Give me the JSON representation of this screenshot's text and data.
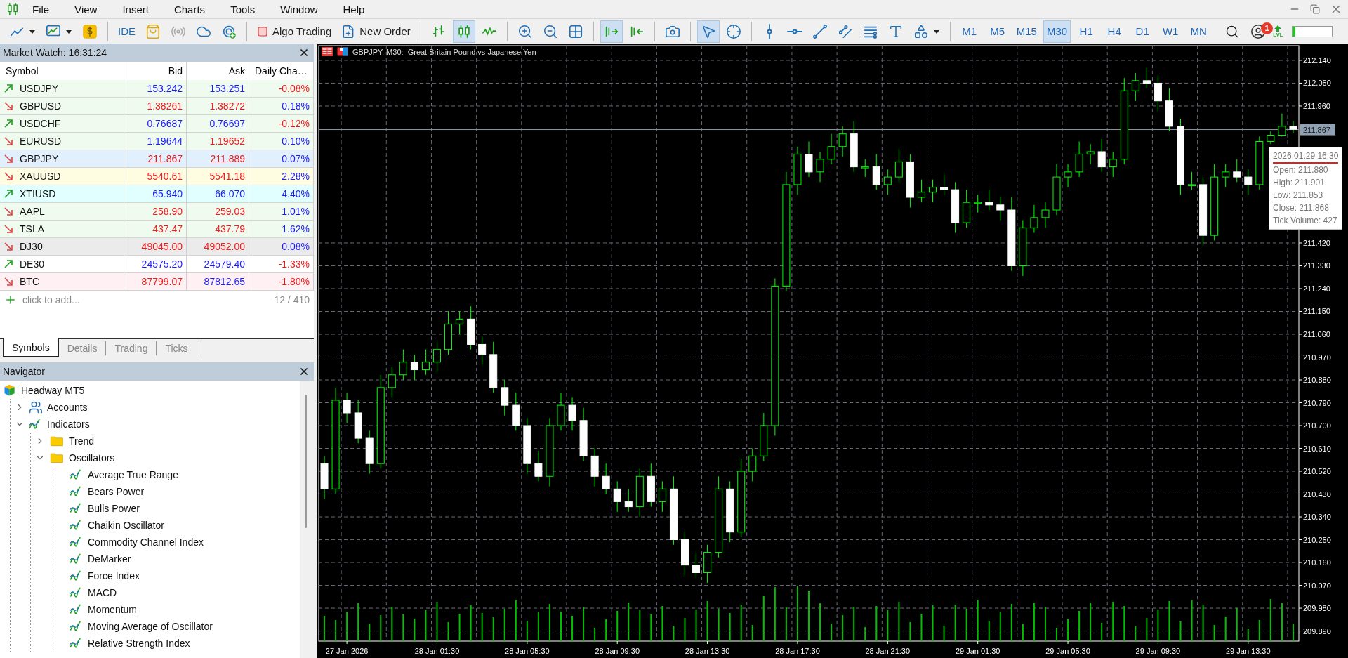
{
  "menu": {
    "items": [
      "File",
      "View",
      "Insert",
      "Charts",
      "Tools",
      "Window",
      "Help"
    ]
  },
  "toolbar": {
    "ide": "IDE",
    "algo_trading": "Algo Trading",
    "new_order": "New Order",
    "chart_types": [
      {
        "kind": "bars",
        "selected": false
      },
      {
        "kind": "candles",
        "selected": true
      },
      {
        "kind": "line",
        "selected": false
      }
    ],
    "autoscroll": {
      "selected": true
    },
    "chart_shift": {
      "selected": false
    },
    "tools": [
      {
        "kind": "cursor",
        "selected": true
      },
      {
        "kind": "crosshair",
        "selected": false
      },
      {
        "kind": "vertical_line",
        "selected": false
      },
      {
        "kind": "horizontal_line",
        "selected": false
      },
      {
        "kind": "trend_line",
        "selected": false
      },
      {
        "kind": "channel",
        "selected": false
      },
      {
        "kind": "fibonacci",
        "selected": false
      },
      {
        "kind": "text",
        "selected": false
      },
      {
        "kind": "shapes",
        "selected": false
      }
    ],
    "timeframes": [
      {
        "label": "M1",
        "selected": false
      },
      {
        "label": "M5",
        "selected": false
      },
      {
        "label": "M15",
        "selected": false
      },
      {
        "label": "M30",
        "selected": true
      },
      {
        "label": "H1",
        "selected": false
      },
      {
        "label": "H4",
        "selected": false
      },
      {
        "label": "D1",
        "selected": false
      },
      {
        "label": "W1",
        "selected": false
      },
      {
        "label": "MN",
        "selected": false
      }
    ],
    "notification_badge": "1",
    "lvl_label": "LVL",
    "meter": {
      "level": 0.08
    }
  },
  "market_watch": {
    "title": "Market Watch: 16:31:24",
    "columns": [
      "Symbol",
      "Bid",
      "Ask",
      "Daily Cha…"
    ],
    "rows": [
      {
        "symbol": "USDJPY",
        "rising": true,
        "bid": {
          "text": "153.242",
          "color": "#1a1aff"
        },
        "ask": {
          "text": "153.251",
          "color": "#1a1aff"
        },
        "change": {
          "text": "-0.08%",
          "color": "#f01818"
        },
        "color": "#f0fbf0"
      },
      {
        "symbol": "GBPUSD",
        "rising": false,
        "bid": {
          "text": "1.38261",
          "color": "#f01818"
        },
        "ask": {
          "text": "1.38272",
          "color": "#f01818"
        },
        "change": {
          "text": "0.18%",
          "color": "#1a1aff"
        },
        "color": "#f0fbf0"
      },
      {
        "symbol": "USDCHF",
        "rising": true,
        "bid": {
          "text": "0.76687",
          "color": "#1a1aff"
        },
        "ask": {
          "text": "0.76697",
          "color": "#1a1aff"
        },
        "change": {
          "text": "-0.12%",
          "color": "#f01818"
        },
        "color": "#f0fbf0"
      },
      {
        "symbol": "EURUSD",
        "rising": false,
        "bid": {
          "text": "1.19644",
          "color": "#1a1aff"
        },
        "ask": {
          "text": "1.19652",
          "color": "#f01818"
        },
        "change": {
          "text": "0.10%",
          "color": "#1a1aff"
        },
        "color": "#f0fbf0"
      },
      {
        "symbol": "GBPJPY",
        "rising": false,
        "bid": {
          "text": "211.867",
          "color": "#f01818"
        },
        "ask": {
          "text": "211.889",
          "color": "#f01818"
        },
        "change": {
          "text": "0.07%",
          "color": "#1a1aff"
        },
        "color": "#e2effc"
      },
      {
        "symbol": "XAUUSD",
        "rising": false,
        "bid": {
          "text": "5540.61",
          "color": "#f01818"
        },
        "ask": {
          "text": "5541.18",
          "color": "#f01818"
        },
        "change": {
          "text": "2.28%",
          "color": "#1a1aff"
        },
        "color": "#fffde1"
      },
      {
        "symbol": "XTIUSD",
        "rising": true,
        "bid": {
          "text": "65.940",
          "color": "#1a1aff"
        },
        "ask": {
          "text": "66.070",
          "color": "#1a1aff"
        },
        "change": {
          "text": "4.40%",
          "color": "#1a1aff"
        },
        "color": "#e1ffff"
      },
      {
        "symbol": "AAPL",
        "rising": false,
        "bid": {
          "text": "258.90",
          "color": "#f01818"
        },
        "ask": {
          "text": "259.03",
          "color": "#f01818"
        },
        "change": {
          "text": "1.01%",
          "color": "#1a1aff"
        },
        "color": "#f0fbf0"
      },
      {
        "symbol": "TSLA",
        "rising": false,
        "bid": {
          "text": "437.47",
          "color": "#f01818"
        },
        "ask": {
          "text": "437.79",
          "color": "#f01818"
        },
        "change": {
          "text": "1.62%",
          "color": "#1a1aff"
        },
        "color": "#f0fbf0"
      },
      {
        "symbol": "DJ30",
        "rising": false,
        "bid": {
          "text": "49045.00",
          "color": "#f01818"
        },
        "ask": {
          "text": "49052.00",
          "color": "#f01818"
        },
        "change": {
          "text": "0.08%",
          "color": "#1a1aff"
        },
        "color": "#ebebeb"
      },
      {
        "symbol": "DE30",
        "rising": true,
        "bid": {
          "text": "24575.20",
          "color": "#1a1aff"
        },
        "ask": {
          "text": "24579.40",
          "color": "#1a1aff"
        },
        "change": {
          "text": "-1.33%",
          "color": "#f01818"
        },
        "color": "#ffffff"
      },
      {
        "symbol": "BTC",
        "rising": false,
        "bid": {
          "text": "87799.07",
          "color": "#f01818"
        },
        "ask": {
          "text": "87812.65",
          "color": "#1a1aff"
        },
        "change": {
          "text": "-1.80%",
          "color": "#f01818"
        },
        "color": "#fff0f3"
      }
    ],
    "add_label": "click to add...",
    "count": "12 / 410",
    "tabs": [
      {
        "label": "Symbols",
        "selected": true
      },
      {
        "label": "Details",
        "selected": false
      },
      {
        "label": "Trading",
        "selected": false
      },
      {
        "label": "Ticks",
        "selected": false
      }
    ]
  },
  "navigator": {
    "title": "Navigator",
    "tree": [
      {
        "label": "Headway MT5",
        "kind": "broker",
        "children": [
          {
            "label": "Accounts",
            "kind": "accounts",
            "expanded": false
          },
          {
            "label": "Indicators",
            "kind": "indicator",
            "expanded": true,
            "children": [
              {
                "label": "Trend",
                "kind": "folder",
                "expanded": false
              },
              {
                "label": "Oscillators",
                "kind": "folder",
                "expanded": true,
                "children": [
                  {
                    "label": "Average True Range",
                    "kind": "indicator"
                  },
                  {
                    "label": "Bears Power",
                    "kind": "indicator"
                  },
                  {
                    "label": "Bulls Power",
                    "kind": "indicator"
                  },
                  {
                    "label": "Chaikin Oscillator",
                    "kind": "indicator"
                  },
                  {
                    "label": "Commodity Channel Index",
                    "kind": "indicator"
                  },
                  {
                    "label": "DeMarker",
                    "kind": "indicator"
                  },
                  {
                    "label": "Force Index",
                    "kind": "indicator"
                  },
                  {
                    "label": "MACD",
                    "kind": "indicator"
                  },
                  {
                    "label": "Momentum",
                    "kind": "indicator"
                  },
                  {
                    "label": "Moving Average of Oscillator",
                    "kind": "indicator"
                  },
                  {
                    "label": "Relative Strength Index",
                    "kind": "indicator"
                  }
                ]
              }
            ]
          }
        ]
      }
    ]
  },
  "chart": {
    "title": "GBPJPY, M30:  Great Britain Pound vs Japanese Yen",
    "tooltip": {
      "time": "2026.01.29 16:30",
      "lines": [
        "Open: 211.880",
        "High: 211.901",
        "Low: 211.853",
        "Close: 211.868",
        "Tick Volume: 427"
      ]
    },
    "chart_data": {
      "type": "candlestick",
      "grid": true,
      "categories": [
        null,
        null,
        "27 Jan 2026",
        null,
        null,
        null,
        null,
        null,
        null,
        null,
        "28 Jan 01:30",
        null,
        null,
        null,
        null,
        null,
        null,
        null,
        "28 Jan 05:30",
        null,
        null,
        null,
        null,
        null,
        null,
        null,
        "28 Jan 09:30",
        null,
        null,
        null,
        null,
        null,
        null,
        null,
        "28 Jan 13:30",
        null,
        null,
        null,
        null,
        null,
        null,
        null,
        "28 Jan 17:30",
        null,
        null,
        null,
        null,
        null,
        null,
        null,
        "28 Jan 21:30",
        null,
        null,
        null,
        null,
        null,
        null,
        null,
        "29 Jan 01:30",
        null,
        null,
        null,
        null,
        null,
        null,
        null,
        "29 Jan 05:30",
        null,
        null,
        null,
        null,
        null,
        null,
        null,
        "29 Jan 09:30",
        null,
        null,
        null,
        null,
        null,
        null,
        null,
        "29 Jan 13:30",
        null,
        null,
        null,
        null
      ],
      "ylim": [
        209.85,
        212.198
      ],
      "ref_lines": [
        {
          "axis": "y",
          "value": 211.867,
          "label": "211.867"
        }
      ],
      "ohlc": [
        [
          210.55,
          210.58,
          210.41,
          210.45
        ],
        [
          210.45,
          210.85,
          210.43,
          210.8
        ],
        [
          210.8,
          210.83,
          210.71,
          210.75
        ],
        [
          210.75,
          210.8,
          210.63,
          210.65
        ],
        [
          210.65,
          210.68,
          210.51,
          210.55
        ],
        [
          210.55,
          210.9,
          210.53,
          210.85
        ],
        [
          210.85,
          210.93,
          210.81,
          210.9
        ],
        [
          210.9,
          211.0,
          210.88,
          210.95
        ],
        [
          210.95,
          210.98,
          210.88,
          210.92
        ],
        [
          210.92,
          211.0,
          210.9,
          210.95
        ],
        [
          210.95,
          211.03,
          210.91,
          211.0
        ],
        [
          211.0,
          211.15,
          210.98,
          211.1
        ],
        [
          211.1,
          211.15,
          211.06,
          211.12
        ],
        [
          211.12,
          211.17,
          211.0,
          211.02
        ],
        [
          211.02,
          211.05,
          210.94,
          210.98
        ],
        [
          210.98,
          211.03,
          210.83,
          210.85
        ],
        [
          210.85,
          210.88,
          210.74,
          210.78
        ],
        [
          210.78,
          210.83,
          210.68,
          210.7
        ],
        [
          210.7,
          210.73,
          210.51,
          210.55
        ],
        [
          210.55,
          210.6,
          210.48,
          210.5
        ],
        [
          210.5,
          210.73,
          210.46,
          210.7
        ],
        [
          210.7,
          210.83,
          210.68,
          210.78
        ],
        [
          210.78,
          210.81,
          210.68,
          210.72
        ],
        [
          210.72,
          210.77,
          210.56,
          210.58
        ],
        [
          210.58,
          210.61,
          210.46,
          210.5
        ],
        [
          210.5,
          210.55,
          210.43,
          210.45
        ],
        [
          210.45,
          210.48,
          210.36,
          210.4
        ],
        [
          210.4,
          210.45,
          210.36,
          210.38
        ],
        [
          210.38,
          210.53,
          210.34,
          210.5
        ],
        [
          210.5,
          210.55,
          210.38,
          210.4
        ],
        [
          210.4,
          210.48,
          210.36,
          210.45
        ],
        [
          210.45,
          210.5,
          210.23,
          210.25
        ],
        [
          210.25,
          210.28,
          210.11,
          210.15
        ],
        [
          210.15,
          210.2,
          210.1,
          210.12
        ],
        [
          210.12,
          210.23,
          210.08,
          210.2
        ],
        [
          210.2,
          210.5,
          210.18,
          210.45
        ],
        [
          210.45,
          210.48,
          210.24,
          210.28
        ],
        [
          210.28,
          210.57,
          210.26,
          210.52
        ],
        [
          210.52,
          210.61,
          210.48,
          210.58
        ],
        [
          210.58,
          210.75,
          210.56,
          210.7
        ],
        [
          210.7,
          211.28,
          210.66,
          211.25
        ],
        [
          211.25,
          211.7,
          211.23,
          211.65
        ],
        [
          211.65,
          211.8,
          211.61,
          211.77
        ],
        [
          211.77,
          211.82,
          211.68,
          211.7
        ],
        [
          211.7,
          211.78,
          211.66,
          211.75
        ],
        [
          211.75,
          211.85,
          211.73,
          211.8
        ],
        [
          211.8,
          211.88,
          211.76,
          211.85
        ],
        [
          211.85,
          211.9,
          211.7,
          211.72
        ],
        [
          211.72,
          211.75,
          211.68,
          211.72
        ],
        [
          211.72,
          211.77,
          211.63,
          211.65
        ],
        [
          211.65,
          211.71,
          211.61,
          211.68
        ],
        [
          211.68,
          211.79,
          211.66,
          211.74
        ],
        [
          211.74,
          211.77,
          211.56,
          211.6
        ],
        [
          211.6,
          211.67,
          211.58,
          211.62
        ],
        [
          211.62,
          211.67,
          211.58,
          211.64
        ],
        [
          211.64,
          211.69,
          211.61,
          211.63
        ],
        [
          211.63,
          211.66,
          211.46,
          211.5
        ],
        [
          211.5,
          211.63,
          211.48,
          211.58
        ],
        [
          211.58,
          211.61,
          211.54,
          211.58
        ],
        [
          211.58,
          211.63,
          211.55,
          211.57
        ],
        [
          211.57,
          211.6,
          211.51,
          211.55
        ],
        [
          211.55,
          211.6,
          211.31,
          211.33
        ],
        [
          211.33,
          211.51,
          211.29,
          211.48
        ],
        [
          211.48,
          211.57,
          211.46,
          211.52
        ],
        [
          211.52,
          211.58,
          211.48,
          211.55
        ],
        [
          211.55,
          211.73,
          211.53,
          211.68
        ],
        [
          211.68,
          211.73,
          211.64,
          211.7
        ],
        [
          211.7,
          211.82,
          211.68,
          211.77
        ],
        [
          211.77,
          211.81,
          211.73,
          211.78
        ],
        [
          211.78,
          211.83,
          211.7,
          211.72
        ],
        [
          211.72,
          211.78,
          211.68,
          211.75
        ],
        [
          211.75,
          212.07,
          211.73,
          212.02
        ],
        [
          212.02,
          212.09,
          211.98,
          212.06
        ],
        [
          212.06,
          212.11,
          212.03,
          212.05
        ],
        [
          212.05,
          212.08,
          211.94,
          211.98
        ],
        [
          211.98,
          212.03,
          211.86,
          211.88
        ],
        [
          211.88,
          211.91,
          211.61,
          211.65
        ],
        [
          211.65,
          211.7,
          211.63,
          211.65
        ],
        [
          211.65,
          211.68,
          211.41,
          211.45
        ],
        [
          211.45,
          211.73,
          211.43,
          211.68
        ],
        [
          211.68,
          211.73,
          211.64,
          211.7
        ],
        [
          211.7,
          211.75,
          211.66,
          211.68
        ],
        [
          211.68,
          211.71,
          211.61,
          211.65
        ],
        [
          211.65,
          211.84,
          211.63,
          211.82
        ],
        [
          211.82,
          211.86,
          211.81,
          211.845
        ],
        [
          211.845,
          211.93,
          211.84,
          211.88
        ],
        [
          211.88,
          211.901,
          211.853,
          211.868
        ]
      ],
      "yticks": [
        {
          "value": 212.14,
          "label": "212.140"
        },
        {
          "value": 212.05,
          "label": "212.050"
        },
        {
          "value": 211.96,
          "label": "211.960"
        },
        {
          "value": 211.42,
          "label": "211.420"
        },
        {
          "value": 211.33,
          "label": "211.330"
        },
        {
          "value": 211.24,
          "label": "211.240"
        },
        {
          "value": 211.15,
          "label": "211.150"
        },
        {
          "value": 211.06,
          "label": "211.060"
        },
        {
          "value": 210.97,
          "label": "210.970"
        },
        {
          "value": 210.88,
          "label": "210.880"
        },
        {
          "value": 210.79,
          "label": "210.790"
        },
        {
          "value": 210.7,
          "label": "210.700"
        },
        {
          "value": 210.61,
          "label": "210.610"
        },
        {
          "value": 210.52,
          "label": "210.520"
        },
        {
          "value": 210.43,
          "label": "210.430"
        },
        {
          "value": 210.34,
          "label": "210.340"
        },
        {
          "value": 210.25,
          "label": "210.250"
        },
        {
          "value": 210.16,
          "label": "210.160"
        },
        {
          "value": 210.07,
          "label": "210.070"
        },
        {
          "value": 209.98,
          "label": "209.980"
        },
        {
          "value": 209.89,
          "label": "209.890"
        }
      ]
    }
  }
}
